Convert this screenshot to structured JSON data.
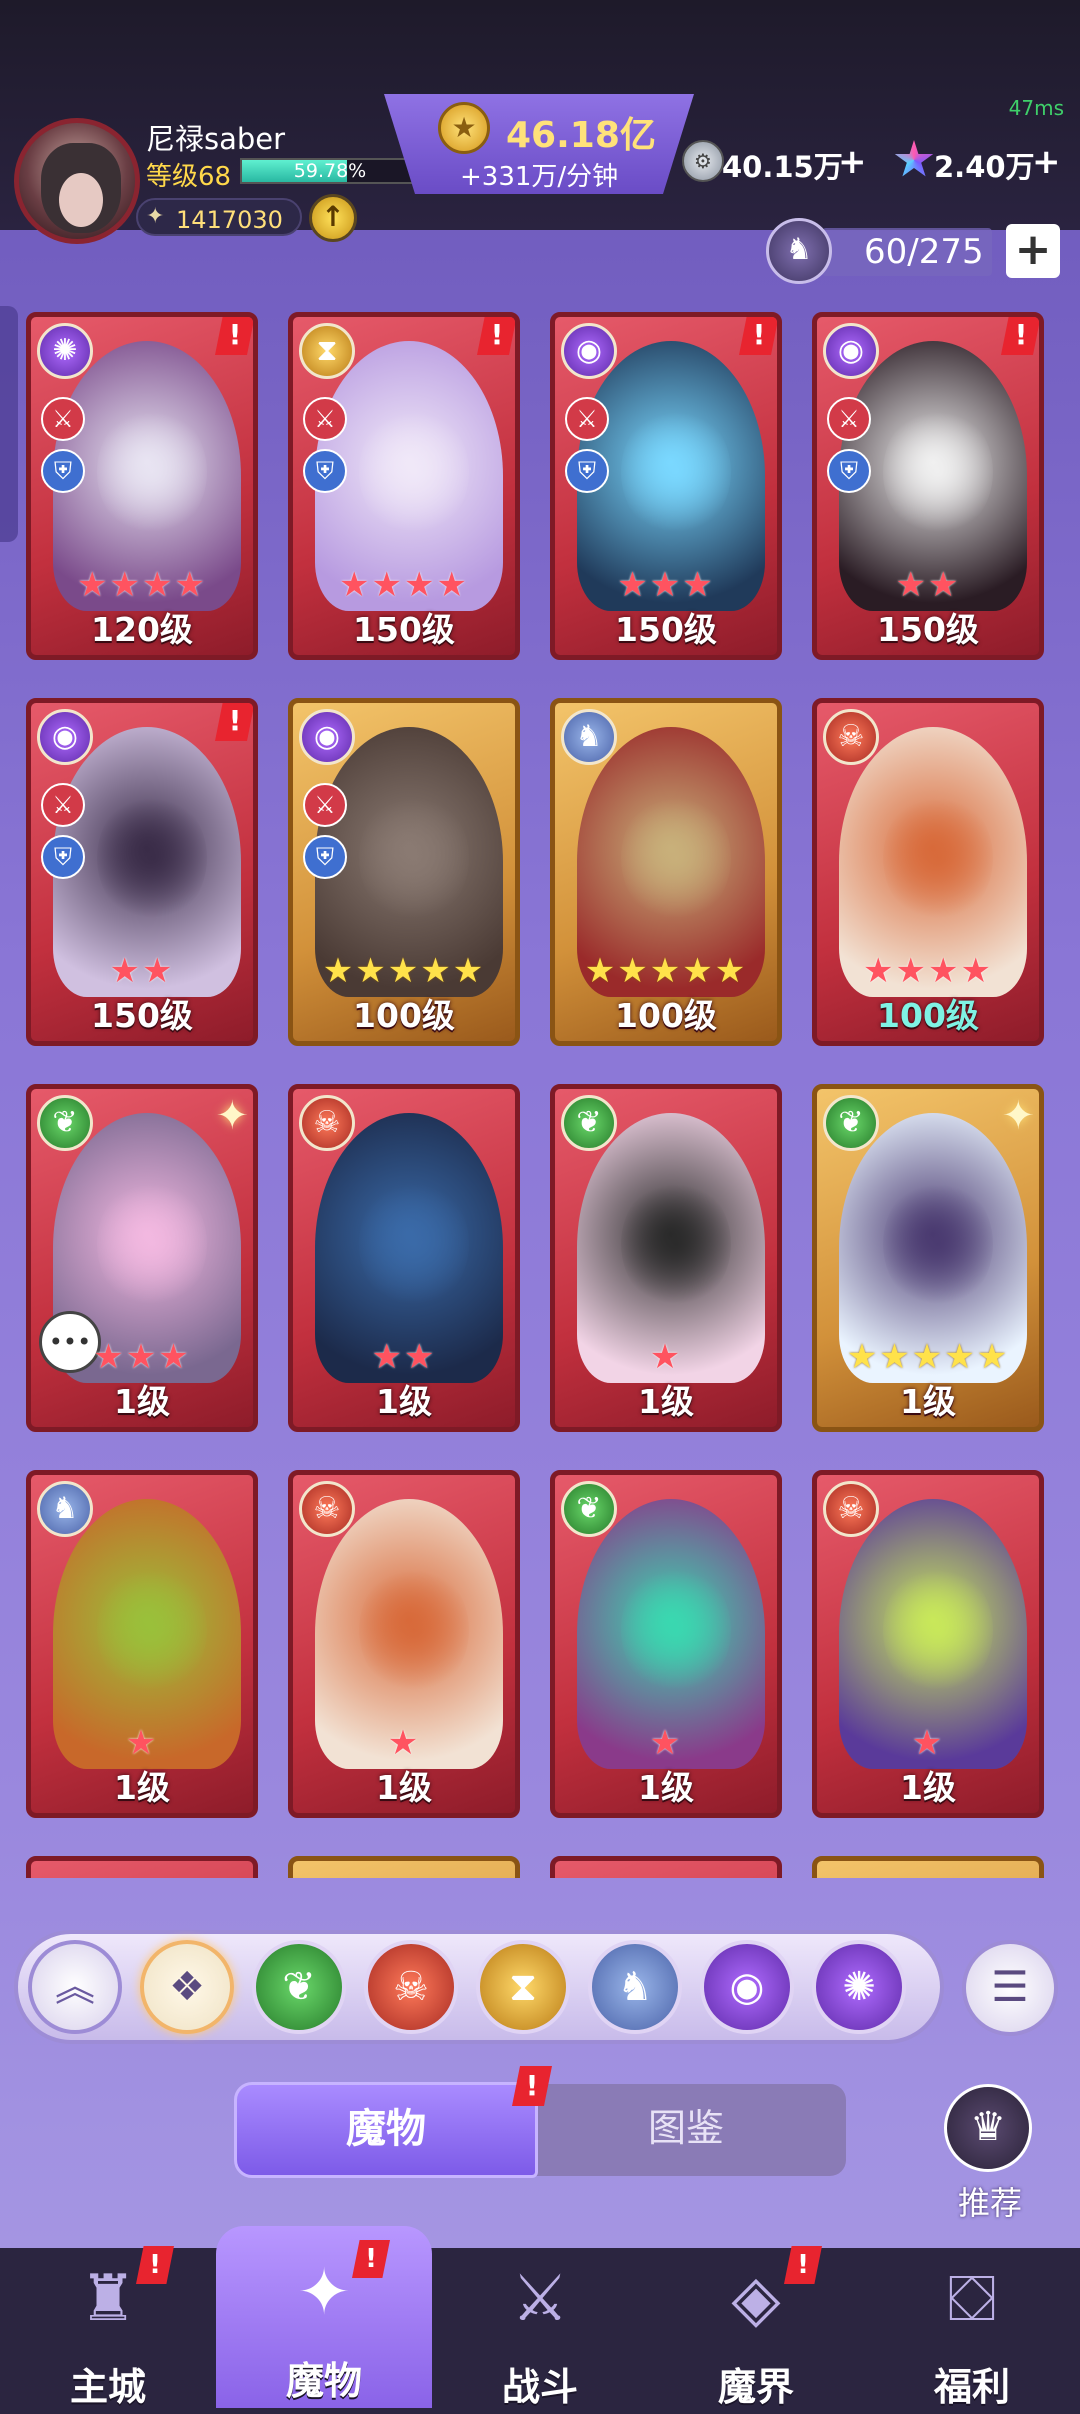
{
  "status": {
    "ping": "47ms"
  },
  "player": {
    "name": "尼禄saber",
    "level_label": "等级68",
    "xp_percent": "59.78%",
    "xp_fraction": 0.5978,
    "power": "1417030"
  },
  "currency": {
    "gold": "46.18亿",
    "gold_rate": "+331万/分钟",
    "silver": "40.15万",
    "gem": "2.40万"
  },
  "capacity": {
    "text": "60/275"
  },
  "cards": [
    {
      "level": "120级",
      "stars": "★★★★",
      "star_color": "red",
      "faction": "purple-swirl",
      "frame": "red",
      "alert": true,
      "roles": [
        "sword",
        "shield"
      ]
    },
    {
      "level": "150级",
      "stars": "★★★★",
      "star_color": "red",
      "faction": "hourglass",
      "frame": "red",
      "alert": true,
      "roles": [
        "sword",
        "shield"
      ]
    },
    {
      "level": "150级",
      "stars": "★★★",
      "star_color": "red",
      "faction": "eye",
      "frame": "red",
      "alert": true,
      "roles": [
        "sword",
        "shield"
      ]
    },
    {
      "level": "150级",
      "stars": "★★",
      "star_color": "red",
      "faction": "eye",
      "frame": "red",
      "alert": true,
      "roles": [
        "sword",
        "shield"
      ]
    },
    {
      "level": "150级",
      "stars": "★★",
      "star_color": "red",
      "faction": "eye",
      "frame": "red",
      "alert": true,
      "roles": [
        "sword",
        "shield"
      ]
    },
    {
      "level": "100级",
      "stars": "★★★★★",
      "star_color": "gold",
      "faction": "eye",
      "frame": "gold",
      "alert": false,
      "roles": [
        "sword",
        "shield"
      ]
    },
    {
      "level": "100级",
      "stars": "★★★★★",
      "star_color": "gold",
      "faction": "wolf",
      "frame": "gold",
      "alert": false,
      "roles": []
    },
    {
      "level": "100级",
      "stars": "★★★★",
      "star_color": "red",
      "faction": "skull",
      "frame": "red",
      "alert": false,
      "roles": [],
      "level_teal": true
    },
    {
      "level": "1级",
      "stars": "★★★",
      "star_color": "red",
      "faction": "leaf",
      "frame": "red",
      "alert": false,
      "sparkle": true,
      "roles": [],
      "chat": true
    },
    {
      "level": "1级",
      "stars": "★★",
      "star_color": "red",
      "faction": "skull",
      "frame": "red",
      "alert": false,
      "roles": []
    },
    {
      "level": "1级",
      "stars": "★",
      "star_color": "red",
      "faction": "leaf",
      "frame": "red",
      "alert": false,
      "roles": []
    },
    {
      "level": "1级",
      "stars": "★★★★★",
      "star_color": "gold",
      "faction": "leaf",
      "frame": "gold",
      "alert": false,
      "sparkle": true,
      "roles": []
    },
    {
      "level": "1级",
      "stars": "★",
      "star_color": "red",
      "faction": "wolf",
      "frame": "red",
      "alert": false,
      "roles": []
    },
    {
      "level": "1级",
      "stars": "★",
      "star_color": "red",
      "faction": "skull",
      "frame": "red",
      "alert": false,
      "roles": []
    },
    {
      "level": "1级",
      "stars": "★",
      "star_color": "red",
      "faction": "leaf",
      "frame": "red",
      "alert": false,
      "roles": []
    },
    {
      "level": "1级",
      "stars": "★",
      "star_color": "red",
      "faction": "skull",
      "frame": "red",
      "alert": false,
      "roles": []
    }
  ],
  "filters": [
    {
      "name": "collapse",
      "icon": "chevron-up"
    },
    {
      "name": "all",
      "icon": "diamond-grid"
    },
    {
      "name": "leaf",
      "icon": "leaf"
    },
    {
      "name": "skull",
      "icon": "skull"
    },
    {
      "name": "hourglass",
      "icon": "hourglass"
    },
    {
      "name": "wolf",
      "icon": "wolf"
    },
    {
      "name": "eye",
      "icon": "eye"
    },
    {
      "name": "purple-swirl",
      "icon": "swirl"
    }
  ],
  "tabs": {
    "active": "魔物",
    "inactive": "图鉴"
  },
  "recommend": {
    "label": "推荐"
  },
  "nav": [
    {
      "label": "主城",
      "icon": "castle",
      "alert": true,
      "active": false
    },
    {
      "label": "魔物",
      "icon": "flame-star",
      "alert": true,
      "active": true
    },
    {
      "label": "战斗",
      "icon": "sword-shield",
      "alert": false,
      "active": false
    },
    {
      "label": "魔界",
      "icon": "portal",
      "alert": true,
      "active": false
    },
    {
      "label": "福利",
      "icon": "chest",
      "alert": false,
      "active": false
    }
  ],
  "colors": {
    "accent": "#7d5be8",
    "alert": "#e8242f",
    "gold": "#ffe27a"
  }
}
